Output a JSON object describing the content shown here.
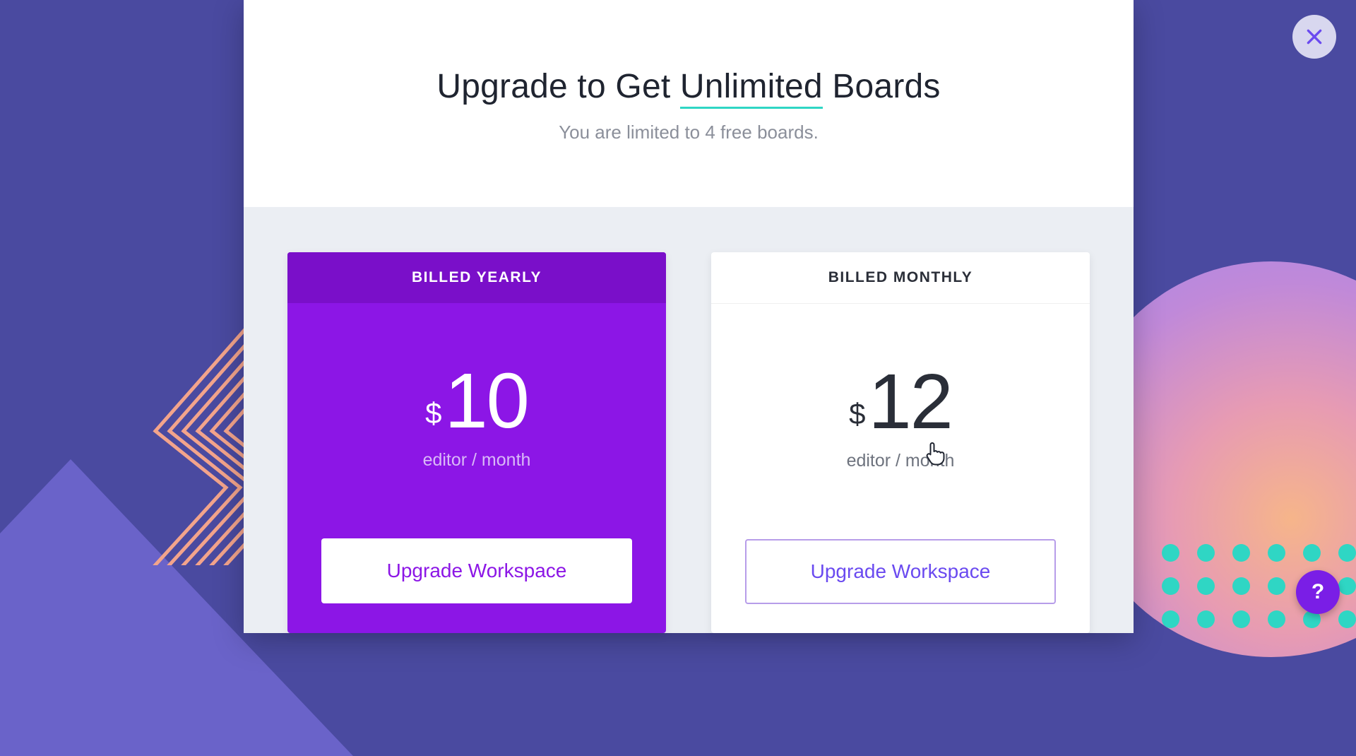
{
  "header": {
    "title_pre": "Upgrade to Get ",
    "title_underlined": "Unlimited",
    "title_post": " Boards",
    "subtitle": "You are limited to 4 free boards."
  },
  "plans": {
    "yearly": {
      "label": "BILLED YEARLY",
      "currency": "$",
      "amount": "10",
      "unit": "editor / month",
      "cta": "Upgrade Workspace"
    },
    "monthly": {
      "label": "BILLED MONTHLY",
      "currency": "$",
      "amount": "12",
      "unit": "editor / month",
      "cta": "Upgrade Workspace"
    }
  },
  "help_label": "?",
  "colors": {
    "accent_purple": "#8c16e6",
    "accent_teal": "#2fd6c4",
    "bg_indigo": "#4a4aa0"
  }
}
